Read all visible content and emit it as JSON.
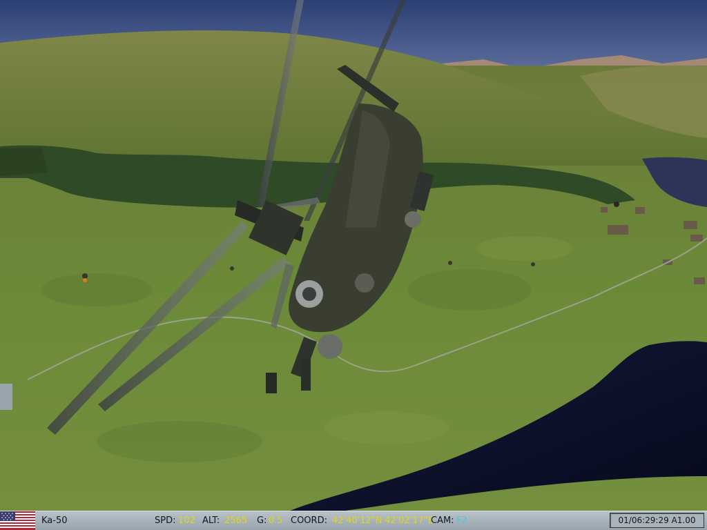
{
  "hud": {
    "aircraft": "Ka-50",
    "speed_label": "SPD:",
    "speed_value": "102",
    "altitude_label": "ALT:",
    "altitude_value": "2565",
    "g_label": "G:",
    "g_value": "0.5",
    "coord_label": "COORD:",
    "latitude": "42'40'12\"N",
    "longitude": "42'02'17\"E",
    "camera_label": "CAM:",
    "camera_value": "F2",
    "time": "01/06:29:29 A1.00"
  },
  "icons": {
    "flag": "usa-flag-icon"
  },
  "colors": {
    "value_yellow": "#e3d51a",
    "value_cyan": "#4fc3e8",
    "status_bar": "#a9b2b9"
  }
}
